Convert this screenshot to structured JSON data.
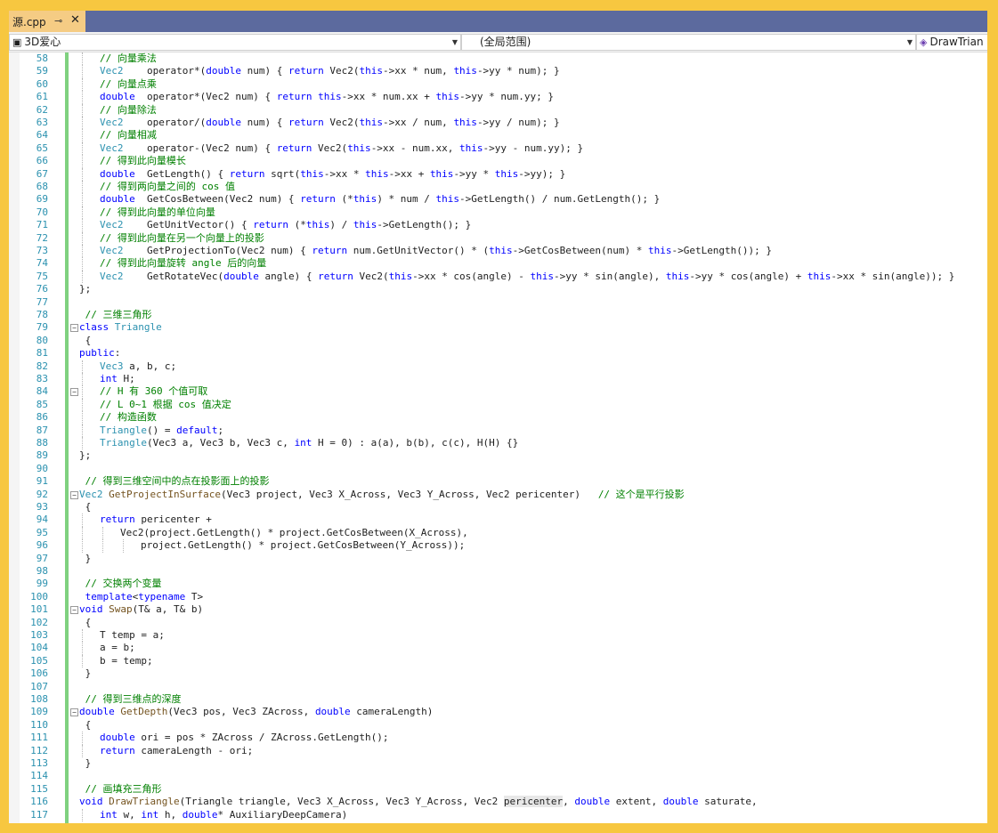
{
  "tab": {
    "title": "源.cpp",
    "pin": "⊸",
    "close": "✕"
  },
  "navbar": {
    "project": "3D爱心",
    "scope": "(全局范围)",
    "member": "DrawTrian"
  },
  "lines": [
    {
      "n": "58",
      "ind": 1,
      "fold": "",
      "t": [
        [
          "cm",
          "// 向量乘法"
        ]
      ]
    },
    {
      "n": "59",
      "ind": 1,
      "fold": "",
      "t": [
        [
          "ty",
          "Vec2"
        ],
        [
          "pl",
          "    operator*("
        ],
        [
          "kw",
          "double"
        ],
        [
          "pl",
          " num) { "
        ],
        [
          "kw",
          "return"
        ],
        [
          "pl",
          " Vec2("
        ],
        [
          "kw",
          "this"
        ],
        [
          "pl",
          "->xx * num, "
        ],
        [
          "kw",
          "this"
        ],
        [
          "pl",
          "->yy * num); }"
        ]
      ]
    },
    {
      "n": "60",
      "ind": 1,
      "fold": "",
      "t": [
        [
          "cm",
          "// 向量点乘"
        ]
      ]
    },
    {
      "n": "61",
      "ind": 1,
      "fold": "",
      "t": [
        [
          "kw",
          "double"
        ],
        [
          "pl",
          "  operator*(Vec2 num) { "
        ],
        [
          "kw",
          "return"
        ],
        [
          "pl",
          " "
        ],
        [
          "kw",
          "this"
        ],
        [
          "pl",
          "->xx * num.xx + "
        ],
        [
          "kw",
          "this"
        ],
        [
          "pl",
          "->yy * num.yy; }"
        ]
      ]
    },
    {
      "n": "62",
      "ind": 1,
      "fold": "",
      "t": [
        [
          "cm",
          "// 向量除法"
        ]
      ]
    },
    {
      "n": "63",
      "ind": 1,
      "fold": "",
      "t": [
        [
          "ty",
          "Vec2"
        ],
        [
          "pl",
          "    operator/("
        ],
        [
          "kw",
          "double"
        ],
        [
          "pl",
          " num) { "
        ],
        [
          "kw",
          "return"
        ],
        [
          "pl",
          " Vec2("
        ],
        [
          "kw",
          "this"
        ],
        [
          "pl",
          "->xx / num, "
        ],
        [
          "kw",
          "this"
        ],
        [
          "pl",
          "->yy / num); }"
        ]
      ]
    },
    {
      "n": "64",
      "ind": 1,
      "fold": "",
      "t": [
        [
          "cm",
          "// 向量相减"
        ]
      ]
    },
    {
      "n": "65",
      "ind": 1,
      "fold": "",
      "t": [
        [
          "ty",
          "Vec2"
        ],
        [
          "pl",
          "    operator-(Vec2 num) { "
        ],
        [
          "kw",
          "return"
        ],
        [
          "pl",
          " Vec2("
        ],
        [
          "kw",
          "this"
        ],
        [
          "pl",
          "->xx - num.xx, "
        ],
        [
          "kw",
          "this"
        ],
        [
          "pl",
          "->yy - num.yy); }"
        ]
      ]
    },
    {
      "n": "66",
      "ind": 1,
      "fold": "",
      "t": [
        [
          "cm",
          "// 得到此向量模长"
        ]
      ]
    },
    {
      "n": "67",
      "ind": 1,
      "fold": "",
      "t": [
        [
          "kw",
          "double"
        ],
        [
          "pl",
          "  GetLength() { "
        ],
        [
          "kw",
          "return"
        ],
        [
          "pl",
          " sqrt("
        ],
        [
          "kw",
          "this"
        ],
        [
          "pl",
          "->xx * "
        ],
        [
          "kw",
          "this"
        ],
        [
          "pl",
          "->xx + "
        ],
        [
          "kw",
          "this"
        ],
        [
          "pl",
          "->yy * "
        ],
        [
          "kw",
          "this"
        ],
        [
          "pl",
          "->yy); }"
        ]
      ]
    },
    {
      "n": "68",
      "ind": 1,
      "fold": "",
      "t": [
        [
          "cm",
          "// 得到两向量之间的 cos 值"
        ]
      ]
    },
    {
      "n": "69",
      "ind": 1,
      "fold": "",
      "t": [
        [
          "kw",
          "double"
        ],
        [
          "pl",
          "  GetCosBetween(Vec2 num) { "
        ],
        [
          "kw",
          "return"
        ],
        [
          "pl",
          " (*"
        ],
        [
          "kw",
          "this"
        ],
        [
          "pl",
          ") * num / "
        ],
        [
          "kw",
          "this"
        ],
        [
          "pl",
          "->GetLength() / num.GetLength(); }"
        ]
      ]
    },
    {
      "n": "70",
      "ind": 1,
      "fold": "",
      "t": [
        [
          "cm",
          "// 得到此向量的单位向量"
        ]
      ]
    },
    {
      "n": "71",
      "ind": 1,
      "fold": "",
      "t": [
        [
          "ty",
          "Vec2"
        ],
        [
          "pl",
          "    GetUnitVector() { "
        ],
        [
          "kw",
          "return"
        ],
        [
          "pl",
          " (*"
        ],
        [
          "kw",
          "this"
        ],
        [
          "pl",
          ") / "
        ],
        [
          "kw",
          "this"
        ],
        [
          "pl",
          "->GetLength(); }"
        ]
      ]
    },
    {
      "n": "72",
      "ind": 1,
      "fold": "",
      "t": [
        [
          "cm",
          "// 得到此向量在另一个向量上的投影"
        ]
      ]
    },
    {
      "n": "73",
      "ind": 1,
      "fold": "",
      "t": [
        [
          "ty",
          "Vec2"
        ],
        [
          "pl",
          "    GetProjectionTo(Vec2 num) { "
        ],
        [
          "kw",
          "return"
        ],
        [
          "pl",
          " num.GetUnitVector() * ("
        ],
        [
          "kw",
          "this"
        ],
        [
          "pl",
          "->GetCosBetween(num) * "
        ],
        [
          "kw",
          "this"
        ],
        [
          "pl",
          "->GetLength()); }"
        ]
      ]
    },
    {
      "n": "74",
      "ind": 1,
      "fold": "",
      "t": [
        [
          "cm",
          "// 得到此向量旋转 angle 后的向量"
        ]
      ]
    },
    {
      "n": "75",
      "ind": 1,
      "fold": "",
      "t": [
        [
          "ty",
          "Vec2"
        ],
        [
          "pl",
          "    GetRotateVec("
        ],
        [
          "kw",
          "double"
        ],
        [
          "pl",
          " angle) { "
        ],
        [
          "kw",
          "return"
        ],
        [
          "pl",
          " Vec2("
        ],
        [
          "kw",
          "this"
        ],
        [
          "pl",
          "->xx * cos(angle) - "
        ],
        [
          "kw",
          "this"
        ],
        [
          "pl",
          "->yy * sin(angle), "
        ],
        [
          "kw",
          "this"
        ],
        [
          "pl",
          "->yy * cos(angle) + "
        ],
        [
          "kw",
          "this"
        ],
        [
          "pl",
          "->xx * sin(angle)); }"
        ]
      ]
    },
    {
      "n": "76",
      "ind": 0,
      "fold": "",
      "t": [
        [
          "pl",
          "};"
        ]
      ]
    },
    {
      "n": "77",
      "ind": 0,
      "fold": "",
      "t": []
    },
    {
      "n": "78",
      "ind": 0,
      "fold": "",
      "t": [
        [
          "cm",
          " // 三维三角形"
        ]
      ]
    },
    {
      "n": "79",
      "ind": 0,
      "fold": "⊟",
      "t": [
        [
          "kw",
          "class"
        ],
        [
          "pl",
          " "
        ],
        [
          "ty",
          "Triangle"
        ]
      ]
    },
    {
      "n": "80",
      "ind": 0,
      "fold": "",
      "t": [
        [
          "pl",
          " {"
        ]
      ]
    },
    {
      "n": "81",
      "ind": 0,
      "fold": "",
      "t": [
        [
          "kw",
          "public"
        ],
        [
          "pl",
          ":"
        ]
      ]
    },
    {
      "n": "82",
      "ind": 1,
      "fold": "",
      "t": [
        [
          "ty",
          "Vec3"
        ],
        [
          "pl",
          " a, b, c;"
        ]
      ]
    },
    {
      "n": "83",
      "ind": 1,
      "fold": "",
      "t": [
        [
          "kw",
          "int"
        ],
        [
          "pl",
          " H;"
        ]
      ]
    },
    {
      "n": "84",
      "ind": 1,
      "fold": "⊟",
      "t": [
        [
          "cm",
          "// H 有 360 个值可取"
        ]
      ]
    },
    {
      "n": "85",
      "ind": 1,
      "fold": "",
      "t": [
        [
          "cm",
          "// L 0~1 根据 cos 值决定"
        ]
      ]
    },
    {
      "n": "86",
      "ind": 1,
      "fold": "",
      "t": [
        [
          "cm",
          "// 构造函数"
        ]
      ]
    },
    {
      "n": "87",
      "ind": 1,
      "fold": "",
      "t": [
        [
          "ty",
          "Triangle"
        ],
        [
          "pl",
          "() = "
        ],
        [
          "kw",
          "default"
        ],
        [
          "pl",
          ";"
        ]
      ]
    },
    {
      "n": "88",
      "ind": 1,
      "fold": "",
      "t": [
        [
          "ty",
          "Triangle"
        ],
        [
          "pl",
          "(Vec3 a, Vec3 b, Vec3 c, "
        ],
        [
          "kw",
          "int"
        ],
        [
          "pl",
          " H = 0) : a(a), b(b), c(c), H(H) {}"
        ]
      ]
    },
    {
      "n": "89",
      "ind": 0,
      "fold": "",
      "t": [
        [
          "pl",
          "};"
        ]
      ]
    },
    {
      "n": "90",
      "ind": 0,
      "fold": "",
      "t": []
    },
    {
      "n": "91",
      "ind": 0,
      "fold": "",
      "t": [
        [
          "cm",
          " // 得到三维空间中的点在投影面上的投影"
        ]
      ]
    },
    {
      "n": "92",
      "ind": 0,
      "fold": "⊟",
      "t": [
        [
          "ty",
          "Vec2"
        ],
        [
          "pl",
          " "
        ],
        [
          "fn",
          "GetProjectInSurface"
        ],
        [
          "pl",
          "(Vec3 project, Vec3 X_Across, Vec3 Y_Across, Vec2 pericenter)   "
        ],
        [
          "cm",
          "// 这个是平行投影"
        ]
      ]
    },
    {
      "n": "93",
      "ind": 0,
      "fold": "",
      "t": [
        [
          "pl",
          " {"
        ]
      ]
    },
    {
      "n": "94",
      "ind": 1,
      "fold": "",
      "t": [
        [
          "kw",
          "return"
        ],
        [
          "pl",
          " pericenter +"
        ]
      ]
    },
    {
      "n": "95",
      "ind": 2,
      "fold": "",
      "t": [
        [
          "pl",
          "Vec2(project.GetLength() * project.GetCosBetween(X_Across),"
        ]
      ]
    },
    {
      "n": "96",
      "ind": 3,
      "fold": "",
      "t": [
        [
          "pl",
          "project.GetLength() * project.GetCosBetween(Y_Across));"
        ]
      ]
    },
    {
      "n": "97",
      "ind": 0,
      "fold": "",
      "t": [
        [
          "pl",
          " }"
        ]
      ]
    },
    {
      "n": "98",
      "ind": 0,
      "fold": "",
      "t": []
    },
    {
      "n": "99",
      "ind": 0,
      "fold": "",
      "t": [
        [
          "cm",
          " // 交换两个变量"
        ]
      ]
    },
    {
      "n": "100",
      "ind": 0,
      "fold": "",
      "t": [
        [
          "kw",
          " template"
        ],
        [
          "pl",
          "<"
        ],
        [
          "kw",
          "typename"
        ],
        [
          "pl",
          " T>"
        ]
      ]
    },
    {
      "n": "101",
      "ind": 0,
      "fold": "⊟",
      "t": [
        [
          "kw",
          "void"
        ],
        [
          "pl",
          " "
        ],
        [
          "fn",
          "Swap"
        ],
        [
          "pl",
          "(T& a, T& b)"
        ]
      ]
    },
    {
      "n": "102",
      "ind": 0,
      "fold": "",
      "t": [
        [
          "pl",
          " {"
        ]
      ]
    },
    {
      "n": "103",
      "ind": 1,
      "fold": "",
      "t": [
        [
          "pl",
          "T temp = a;"
        ]
      ]
    },
    {
      "n": "104",
      "ind": 1,
      "fold": "",
      "t": [
        [
          "pl",
          "a = b;"
        ]
      ]
    },
    {
      "n": "105",
      "ind": 1,
      "fold": "",
      "t": [
        [
          "pl",
          "b = temp;"
        ]
      ]
    },
    {
      "n": "106",
      "ind": 0,
      "fold": "",
      "t": [
        [
          "pl",
          " }"
        ]
      ]
    },
    {
      "n": "107",
      "ind": 0,
      "fold": "",
      "t": []
    },
    {
      "n": "108",
      "ind": 0,
      "fold": "",
      "t": [
        [
          "cm",
          " // 得到三维点的深度"
        ]
      ]
    },
    {
      "n": "109",
      "ind": 0,
      "fold": "⊟",
      "t": [
        [
          "kw",
          "double"
        ],
        [
          "pl",
          " "
        ],
        [
          "fn",
          "GetDepth"
        ],
        [
          "pl",
          "(Vec3 pos, Vec3 ZAcross, "
        ],
        [
          "kw",
          "double"
        ],
        [
          "pl",
          " cameraLength)"
        ]
      ]
    },
    {
      "n": "110",
      "ind": 0,
      "fold": "",
      "t": [
        [
          "pl",
          " {"
        ]
      ]
    },
    {
      "n": "111",
      "ind": 1,
      "fold": "",
      "t": [
        [
          "kw",
          "double"
        ],
        [
          "pl",
          " ori = pos * ZAcross / ZAcross.GetLength();"
        ]
      ]
    },
    {
      "n": "112",
      "ind": 1,
      "fold": "",
      "t": [
        [
          "kw",
          "return"
        ],
        [
          "pl",
          " cameraLength - ori;"
        ]
      ]
    },
    {
      "n": "113",
      "ind": 0,
      "fold": "",
      "t": [
        [
          "pl",
          " }"
        ]
      ]
    },
    {
      "n": "114",
      "ind": 0,
      "fold": "",
      "t": []
    },
    {
      "n": "115",
      "ind": 0,
      "fold": "",
      "t": [
        [
          "cm",
          " // 画填充三角形"
        ]
      ]
    },
    {
      "n": "116",
      "ind": 0,
      "fold": "",
      "t": [
        [
          "kw",
          "void"
        ],
        [
          "pl",
          " "
        ],
        [
          "fn",
          "DrawTriangle"
        ],
        [
          "pl",
          "(Triangle triangle, Vec3 X_Across, Vec3 Y_Across, Vec2 "
        ],
        [
          "hl",
          "pericenter"
        ],
        [
          "pl",
          ", "
        ],
        [
          "kw",
          "double"
        ],
        [
          "pl",
          " extent, "
        ],
        [
          "kw",
          "double"
        ],
        [
          "pl",
          " saturate,"
        ]
      ]
    },
    {
      "n": "117",
      "ind": 1,
      "fold": "",
      "t": [
        [
          "kw",
          "int"
        ],
        [
          "pl",
          " w, "
        ],
        [
          "kw",
          "int"
        ],
        [
          "pl",
          " h, "
        ],
        [
          "kw",
          "double"
        ],
        [
          "pl",
          "* AuxiliaryDeepCamera)"
        ]
      ]
    },
    {
      "n": "",
      "ind": 0,
      "fold": "",
      "t": [
        [
          "pl",
          " {"
        ]
      ]
    }
  ],
  "colors": {
    "keyword": "#0000ff",
    "comment": "#008000",
    "type": "#2b91af",
    "linenum": "#2b91af",
    "tab_active": "#f5cc84",
    "tabbar": "#5c6a9e",
    "border": "#f7c740"
  }
}
